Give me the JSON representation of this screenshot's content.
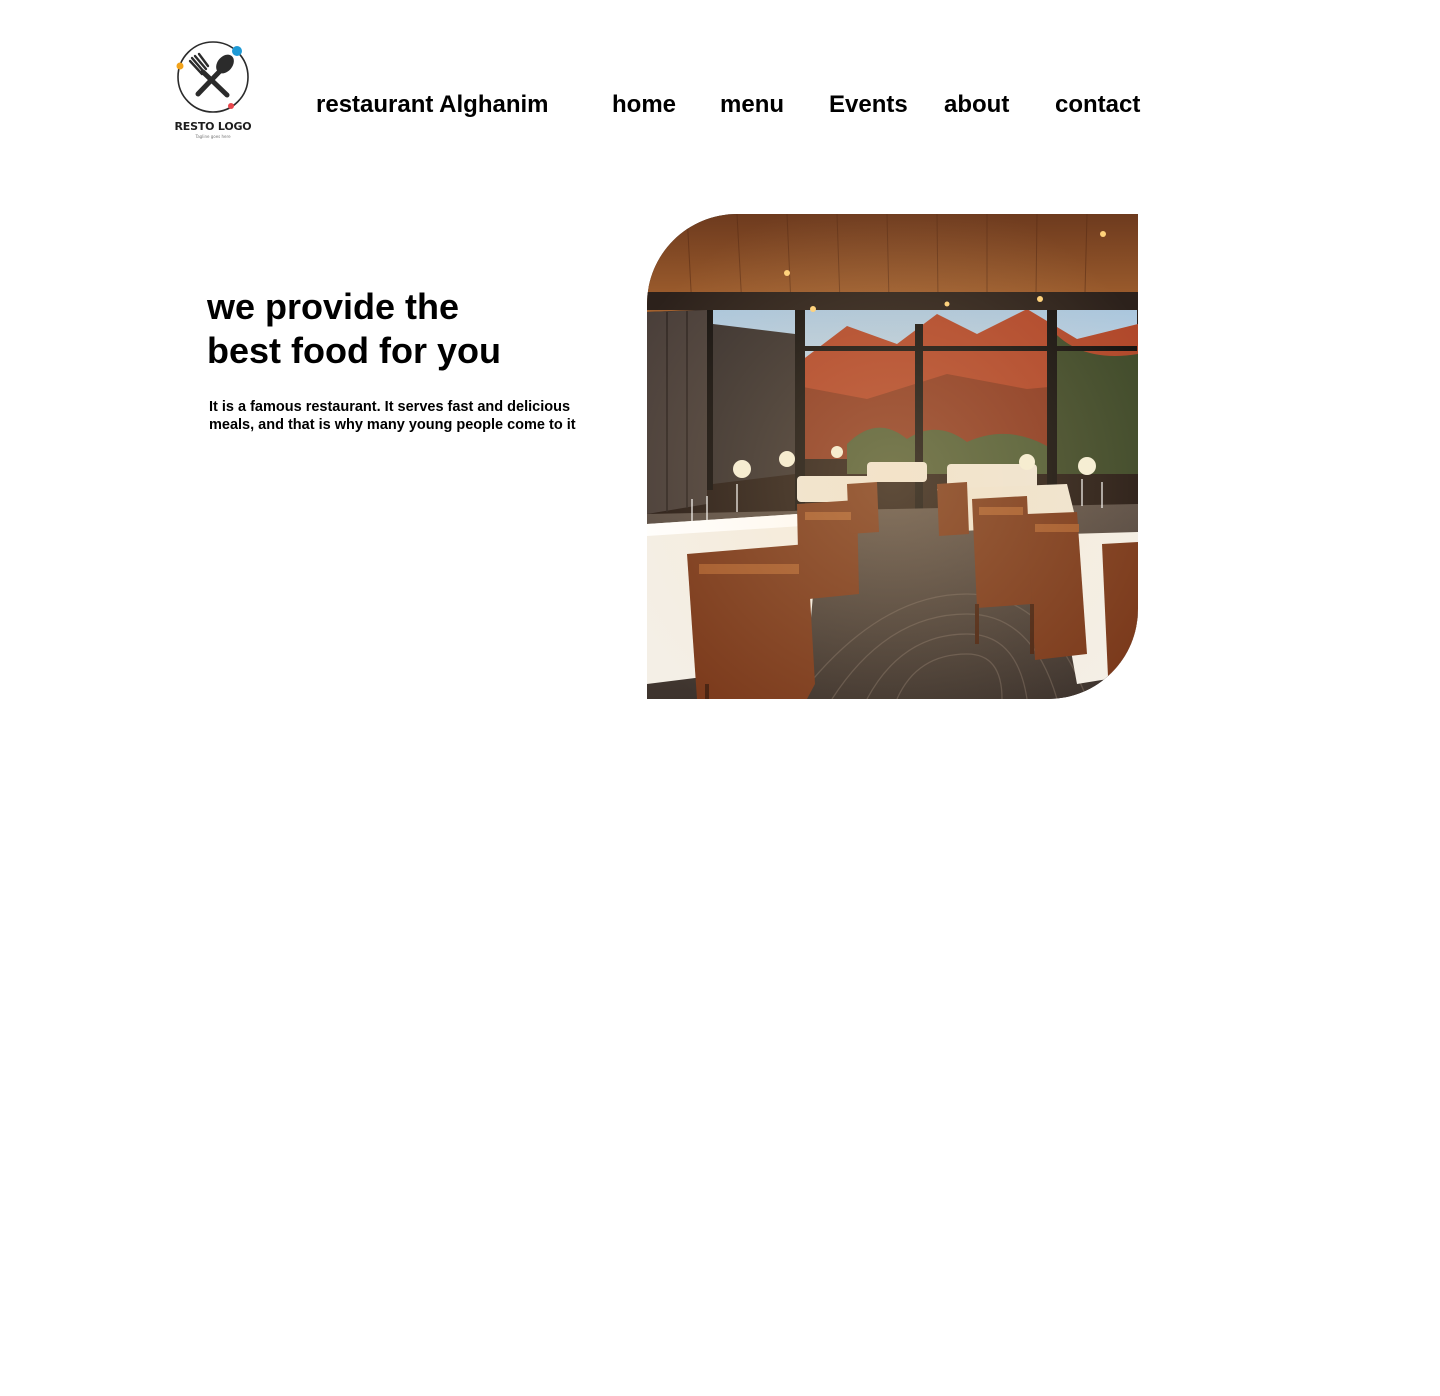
{
  "header": {
    "logo": {
      "title": "RESTO LOGO",
      "tagline": "Tagline goes here",
      "icon": "fork-spoon-icon",
      "colors": {
        "ring": "#2b2b2b",
        "dot_orange": "#f2a31b",
        "dot_blue": "#1e9ad6",
        "dot_red": "#e9474d"
      }
    },
    "brand": "restaurant Alghanim",
    "nav": {
      "home": "home",
      "menu": "menu",
      "events": "Events",
      "about": "about",
      "contact": "contact"
    }
  },
  "hero": {
    "heading_line1": "we provide the",
    "heading_line2": "best food for you",
    "text_line1": "It is a famous restaurant. It serves fast and delicious",
    "text_line2": "meals, and that is why many young people come to it",
    "image": "restaurant-dining-room-photo"
  },
  "colors": {
    "background": "#ffffff",
    "text": "#000000"
  }
}
